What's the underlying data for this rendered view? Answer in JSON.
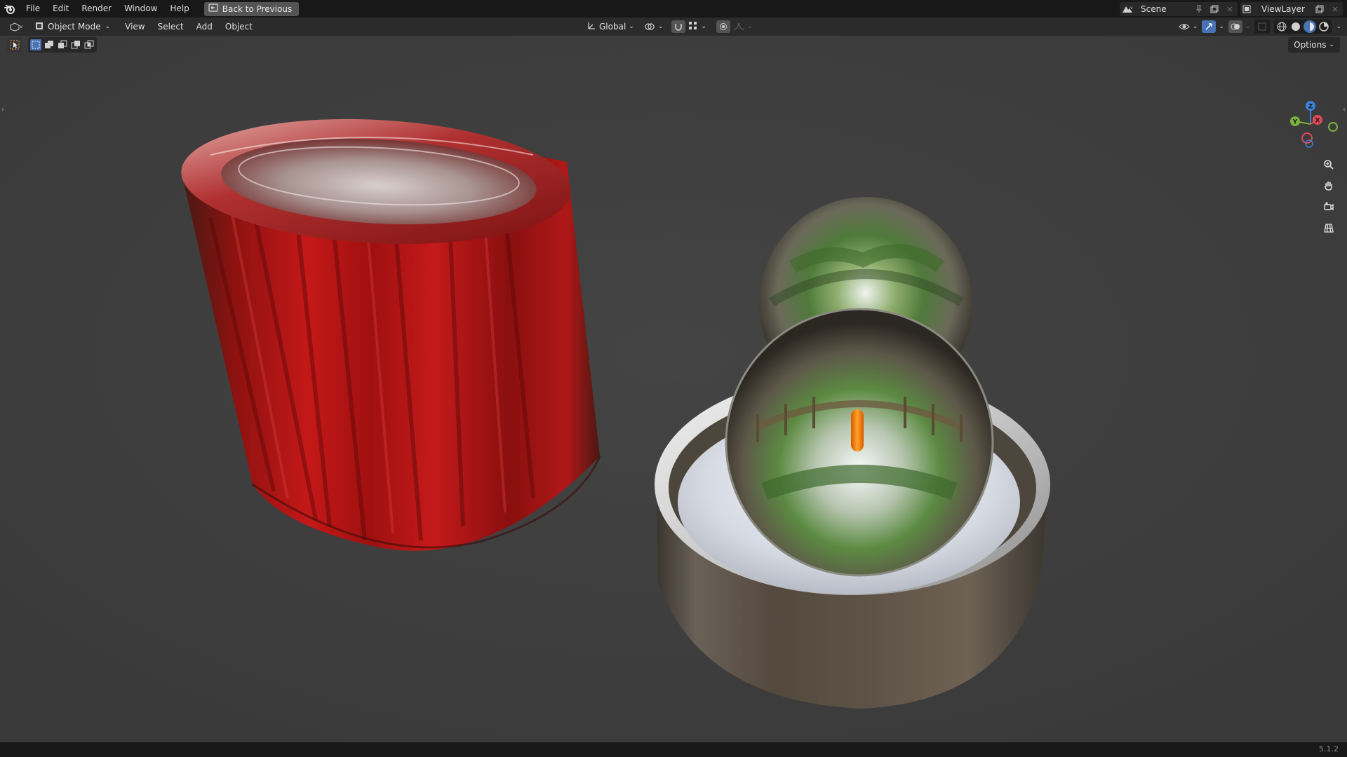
{
  "topbar": {
    "menus": [
      "File",
      "Edit",
      "Render",
      "Window",
      "Help"
    ],
    "back_button": "Back to Previous",
    "scene": "Scene",
    "view_layer": "ViewLayer"
  },
  "viewport_header": {
    "mode": "Object Mode",
    "menus": [
      "View",
      "Select",
      "Add",
      "Object"
    ],
    "orientation": "Global"
  },
  "options_label": "Options",
  "gizmo": {
    "x": "X",
    "y": "Y",
    "z": "Z"
  },
  "status": {
    "version": "5.1.2"
  },
  "colors": {
    "accent": "#4772b3",
    "x_axis": "#e04a56",
    "y_axis": "#7bb33a",
    "z_axis": "#3d82d8"
  }
}
